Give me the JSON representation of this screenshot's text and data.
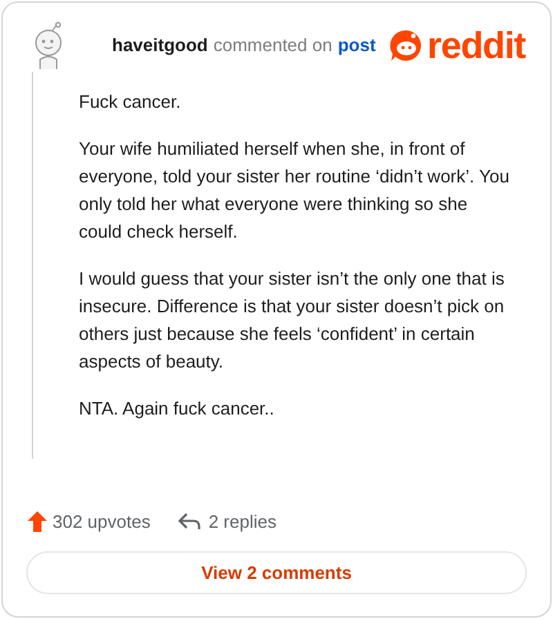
{
  "header": {
    "username": "haveitgood",
    "action": "commented on",
    "link": "post",
    "logo_text": "reddit"
  },
  "paragraphs": [
    "Fuck cancer.",
    "Your wife humiliated herself when she, in front of everyone, told your sister her routine ‘didn’t work’. You only told her what everyone were thinking so she could check herself.",
    "I would guess that your sister isn’t the only one that is insecure. Difference is that your sister doesn’t pick on others just because she feels ‘confident’ in certain aspects of beauty.",
    "NTA. Again fuck cancer.."
  ],
  "footer": {
    "upvotes": "302 upvotes",
    "replies": "2 replies",
    "button": "View 2 comments"
  }
}
